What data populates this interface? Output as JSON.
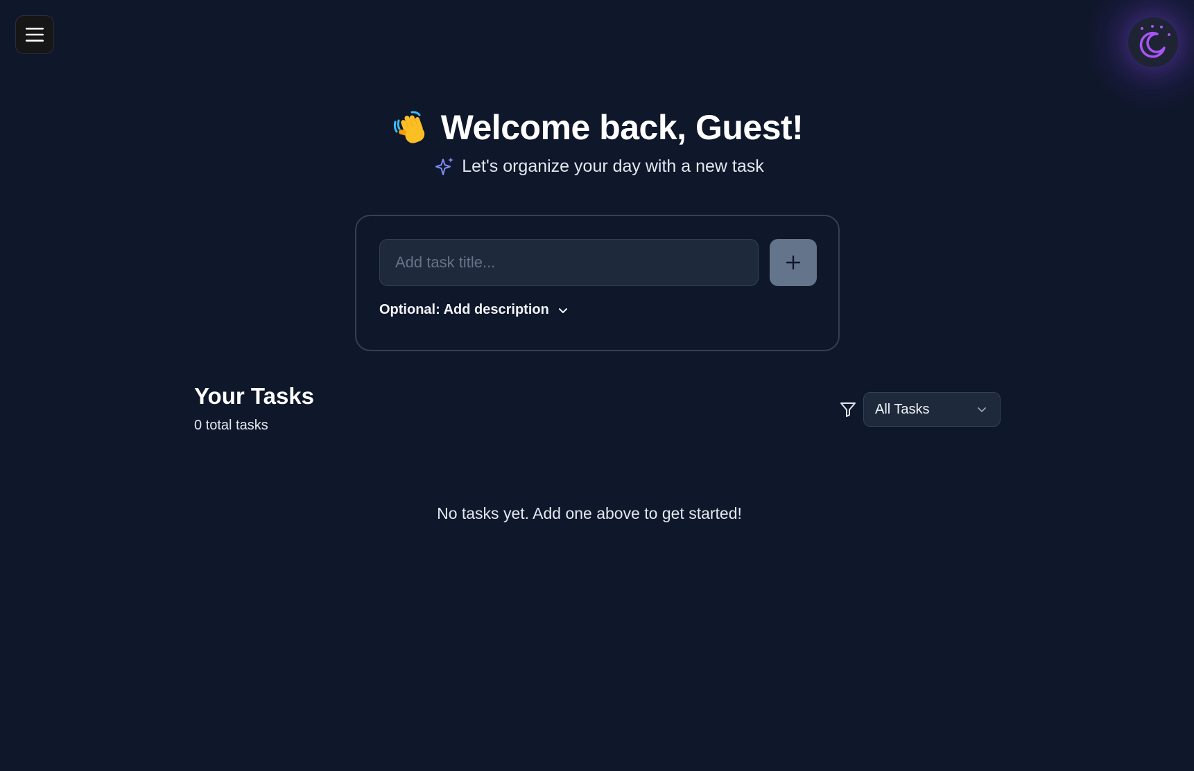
{
  "header": {
    "menu_icon": "hamburger-menu-icon",
    "theme_icon": "moon-icon",
    "accent_color": "#a855f7"
  },
  "hero": {
    "wave_icon": "waving-hand-icon",
    "title": "Welcome back, Guest!",
    "sparkle_icon": "sparkles-icon",
    "subtitle": "Let's organize your day with a new task"
  },
  "task_form": {
    "title_placeholder": "Add task title...",
    "title_value": "",
    "add_icon": "plus-icon",
    "description_toggle_label": "Optional: Add description",
    "description_toggle_icon": "chevron-down-icon"
  },
  "tasks": {
    "title": "Your Tasks",
    "count_label": "0 total tasks",
    "filter_icon": "filter-icon",
    "filter_selected": "All Tasks",
    "empty_message": "No tasks yet. Add one above to get started!"
  }
}
